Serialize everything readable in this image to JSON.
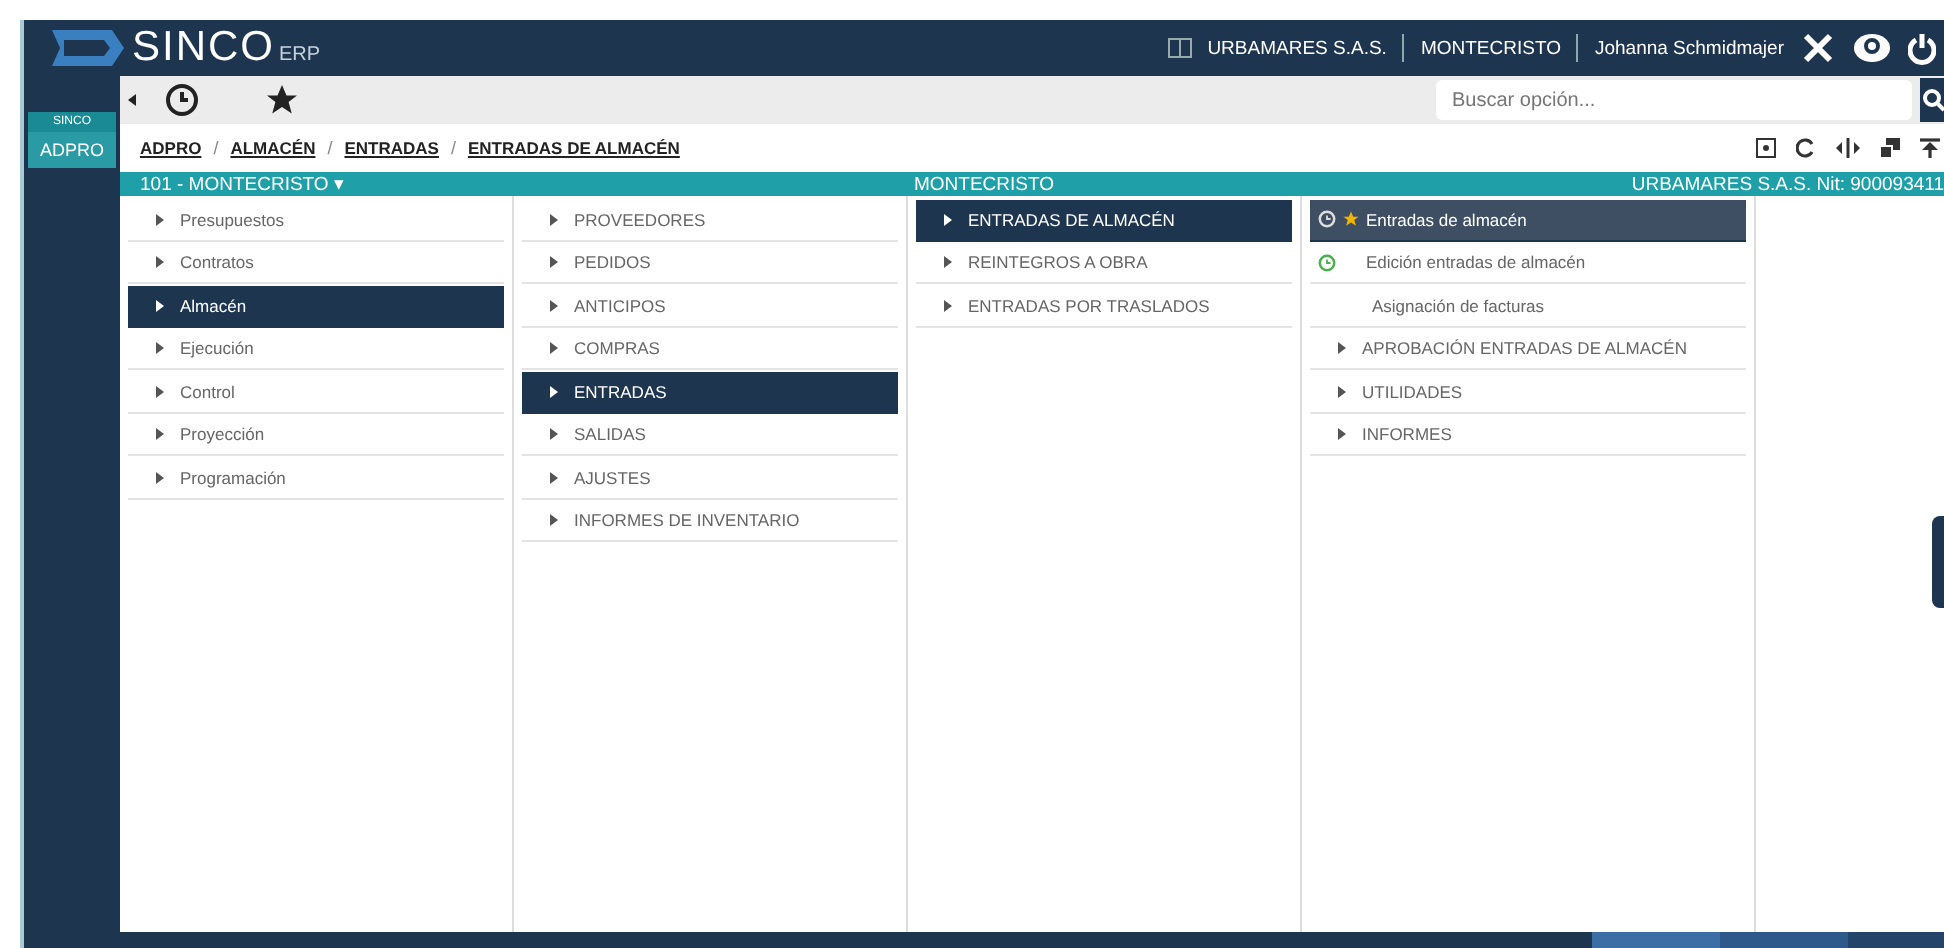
{
  "header": {
    "logo_main": "SINCO",
    "logo_sub": "ERP",
    "company": "URBAMARES S.A.S.",
    "project": "MONTECRISTO",
    "user": "Johanna Schmidmajer"
  },
  "sidebar": {
    "group": "SINCO",
    "module": "ADPRO"
  },
  "search": {
    "placeholder": "Buscar opción..."
  },
  "breadcrumb": [
    "ADPRO",
    "ALMACÉN",
    "ENTRADAS",
    "ENTRADAS DE ALMACÉN"
  ],
  "breadcrumb_separator": "/",
  "info_bar": {
    "project_select": "101 - MONTECRISTO ▾",
    "project": "MONTECRISTO",
    "company": "URBAMARES S.A.S. Nit: 900093411"
  },
  "columns": [
    {
      "items": [
        {
          "label": "Presupuestos",
          "kind": "folder",
          "selected": false
        },
        {
          "label": "Contratos",
          "kind": "folder",
          "selected": false
        },
        {
          "label": "Almacén",
          "kind": "folder",
          "selected": true
        },
        {
          "label": "Ejecución",
          "kind": "folder",
          "selected": false
        },
        {
          "label": "Control",
          "kind": "folder",
          "selected": false
        },
        {
          "label": "Proyección",
          "kind": "folder",
          "selected": false
        },
        {
          "label": "Programación",
          "kind": "folder",
          "selected": false
        }
      ]
    },
    {
      "items": [
        {
          "label": "PROVEEDORES",
          "kind": "folder",
          "selected": false
        },
        {
          "label": "PEDIDOS",
          "kind": "folder",
          "selected": false
        },
        {
          "label": "ANTICIPOS",
          "kind": "folder",
          "selected": false
        },
        {
          "label": "COMPRAS",
          "kind": "folder",
          "selected": false
        },
        {
          "label": "ENTRADAS",
          "kind": "folder",
          "selected": true
        },
        {
          "label": "SALIDAS",
          "kind": "folder",
          "selected": false
        },
        {
          "label": "AJUSTES",
          "kind": "folder",
          "selected": false
        },
        {
          "label": "INFORMES DE INVENTARIO",
          "kind": "folder",
          "selected": false
        }
      ]
    },
    {
      "items": [
        {
          "label": "ENTRADAS DE ALMACÉN",
          "kind": "folder",
          "selected": true
        },
        {
          "label": "REINTEGROS A OBRA",
          "kind": "folder",
          "selected": false
        },
        {
          "label": "ENTRADAS POR TRASLADOS",
          "kind": "folder",
          "selected": false
        }
      ]
    },
    {
      "items": [
        {
          "label": "Entradas de almacén",
          "kind": "favorite",
          "selected": true
        },
        {
          "label": "Edición entradas de almacén",
          "kind": "recent",
          "selected": false
        },
        {
          "label": "Asignación de facturas",
          "kind": "option",
          "selected": false
        },
        {
          "label": "APROBACIÓN ENTRADAS DE ALMACÉN",
          "kind": "folder",
          "selected": false
        },
        {
          "label": "UTILIDADES",
          "kind": "folder",
          "selected": false
        },
        {
          "label": "INFORMES",
          "kind": "folder",
          "selected": false
        }
      ]
    }
  ]
}
